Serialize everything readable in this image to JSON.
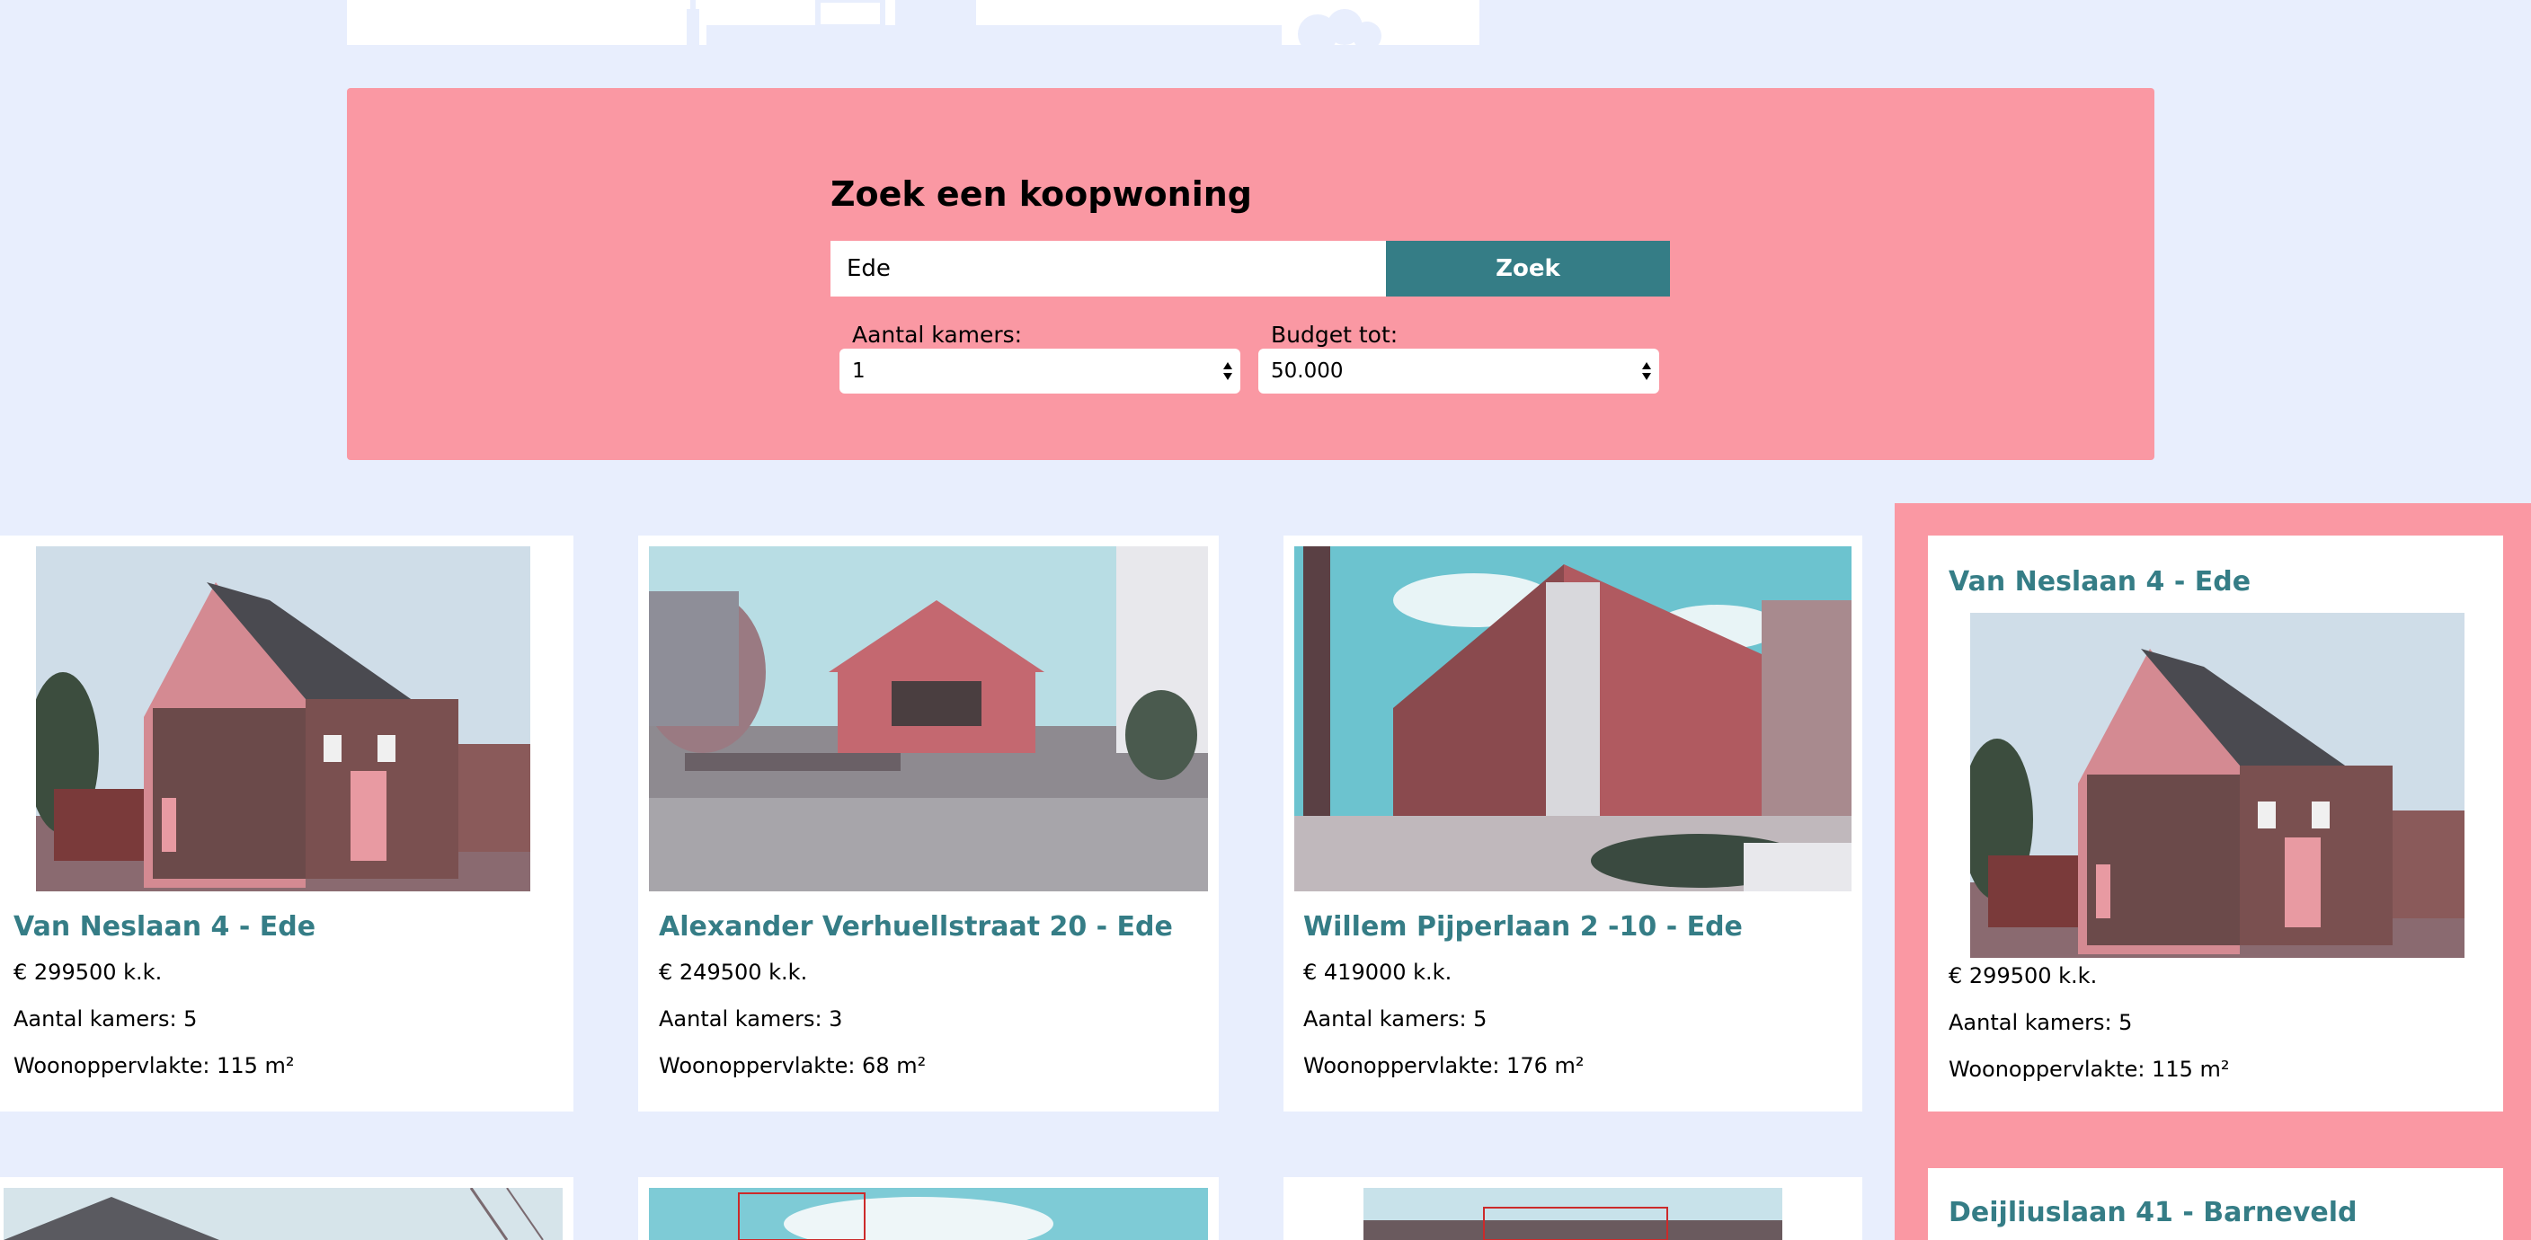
{
  "search": {
    "title": "Zoek een koopwoning",
    "input_value": "Ede",
    "button_label": "Zoek",
    "rooms_label": "Aantal kamers:",
    "rooms_value": "1",
    "budget_label": "Budget tot:",
    "budget_value": "50.000"
  },
  "listings": [
    {
      "title": "Van Neslaan 4 - Ede",
      "price": "€ 299500 k.k.",
      "rooms": "Aantal kamers: 5",
      "area": "Woonoppervlakte: 115 m²"
    },
    {
      "title": "Alexander Verhuellstraat 20 - Ede",
      "price": "€ 249500 k.k.",
      "rooms": "Aantal kamers: 3",
      "area": "Woonoppervlakte: 68 m²"
    },
    {
      "title": "Willem Pijperlaan 2 -10 - Ede",
      "price": "€ 419000 k.k.",
      "rooms": "Aantal kamers: 5",
      "area": "Woonoppervlakte: 176 m²"
    }
  ],
  "sidebar": {
    "featured": {
      "title": "Van Neslaan 4 - Ede",
      "price": "€ 299500 k.k.",
      "rooms": "Aantal kamers: 5",
      "area": "Woonoppervlakte: 115 m²"
    },
    "next_title": "Deijliuslaan 41 - Barneveld"
  },
  "colors": {
    "page_bg": "#e8eefd",
    "accent_pink": "#fa98a3",
    "accent_teal": "#357d86"
  }
}
